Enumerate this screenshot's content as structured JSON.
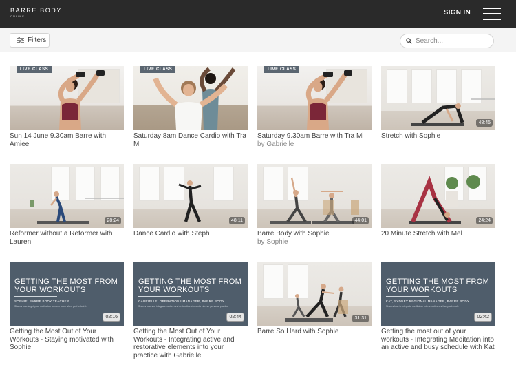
{
  "header": {
    "logo_main": "BARRE BODY",
    "logo_sub": "ONLINE",
    "signin_label": "SIGN IN"
  },
  "filters": {
    "button_label": "Filters",
    "search_placeholder": "Search..."
  },
  "colors": {
    "topbar": "#2a2a2a",
    "slate": "#4f5d6b",
    "live_badge": "#5b6671"
  },
  "videos": [
    {
      "title": "Sun 14 June 9.30am Barre with Amiee",
      "author": "",
      "badge": "LIVE CLASS",
      "duration": ""
    },
    {
      "title": "Saturday 8am Dance Cardio with Tra Mi",
      "author": "",
      "badge": "LIVE CLASS",
      "duration": ""
    },
    {
      "title": "Saturday 9.30am Barre with Tra Mi",
      "author": "by Gabrielle",
      "badge": "LIVE CLASS",
      "duration": ""
    },
    {
      "title": "Stretch with Sophie",
      "author": "",
      "badge": "",
      "duration": "48:45"
    },
    {
      "title": "Reformer without a Reformer with Lauren",
      "author": "",
      "badge": "",
      "duration": "28:24"
    },
    {
      "title": "Dance Cardio with Steph",
      "author": "",
      "badge": "",
      "duration": "48:11"
    },
    {
      "title": "Barre Body with Sophie",
      "author": "by Sophie",
      "badge": "",
      "duration": "44:01"
    },
    {
      "title": "20 Minute Stretch with Mel",
      "author": "",
      "badge": "",
      "duration": "24:24"
    },
    {
      "title": "Getting the Most Out of Your Workouts - Staying motivated with Sophie",
      "author": "",
      "badge": "",
      "duration": "02:16",
      "slate_title": "GETTING THE MOST FROM YOUR WORKOUTS",
      "slate_sub": "SOPHIE, BARRE BODY TEACHER",
      "slate_desc": "Shares how to get your motivation to move back when you've lost it."
    },
    {
      "title": "Getting the Most Out of Your Workouts - Integrating active and restorative elements into your practice with Gabrielle",
      "author": "",
      "badge": "",
      "duration": "02:44",
      "slate_title": "GETTING THE MOST FROM YOUR WORKOUTS",
      "slate_sub": "GABRIELLE, OPERATIONS MANAGER, BARRE BODY",
      "slate_desc": "Shares how she integrates active and restorative elements into her personal practice"
    },
    {
      "title": "Barre So Hard with Sophie",
      "author": "",
      "badge": "",
      "duration": "31:31"
    },
    {
      "title": "Getting the most out of your workouts - Integrating Meditation into an active and busy schedule with Kat",
      "author": "",
      "badge": "",
      "duration": "02:42",
      "slate_title": "GETTING THE MOST FROM YOUR WORKOUTS",
      "slate_sub": "KAT, SYDNEY REGIONAL MANAGER, BARRE BODY",
      "slate_desc": "Shares how to integrate meditation into an active and busy schedule"
    }
  ]
}
